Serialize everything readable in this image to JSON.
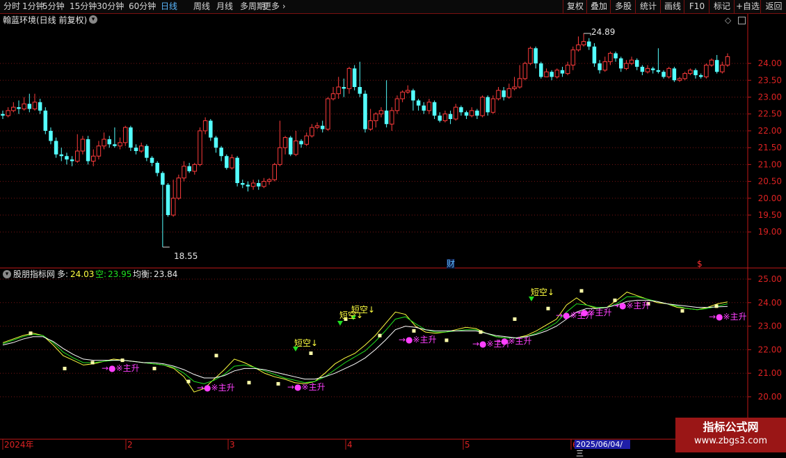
{
  "toolbar": {
    "periods": [
      "分时",
      "1分钟",
      "5分钟",
      "15分钟",
      "30分钟",
      "60分钟",
      "日线",
      "周线",
      "月线",
      "多周期",
      "更多"
    ],
    "active_period": "日线",
    "right_buttons": [
      "复权",
      "叠加",
      "多股",
      "统计",
      "画线",
      "F10",
      "标记",
      "+自选",
      "返回"
    ]
  },
  "main": {
    "title": "翰蓝环境(日线 前复权)",
    "high_label": "24.89",
    "low_label": "18.55",
    "fin_marker": "财",
    "dollar_marker": "$",
    "price_ticks": [
      "24.00",
      "23.50",
      "23.00",
      "22.50",
      "22.00",
      "21.50",
      "21.00",
      "20.50",
      "20.00",
      "19.50",
      "19.00"
    ]
  },
  "indicator": {
    "name": "股朋指标网",
    "duo_label": "多:",
    "duo_value": "24.03",
    "kong_label": "空:",
    "kong_value": "23.95",
    "jun_label": "均衡:",
    "jun_value": "23.84",
    "ticks": [
      "25.00",
      "24.00",
      "23.00",
      "22.00",
      "21.00",
      "20.00"
    ],
    "short_label": "短空↓",
    "main_up_label": "→●※主升"
  },
  "xaxis": {
    "labels": [
      "2024年",
      "2",
      "3",
      "4",
      "5",
      "6"
    ],
    "cursor_date": "2025/06/04/三"
  },
  "watermark": {
    "line1": "指标公式网",
    "line2": "www.zbgs3.com"
  },
  "colors": {
    "up": "#ff3c3c",
    "down": "#54ffff",
    "grid": "#7a1414",
    "axis": "#c01818",
    "yellow": "#ffff40",
    "magenta": "#ff40ff",
    "green": "#20e020"
  },
  "chart_data": [
    {
      "type": "candlestick",
      "title": "翰蓝环境(日线 前复权)",
      "ylim": [
        18.55,
        24.89
      ],
      "note_high": 24.89,
      "note_low": 18.55,
      "candles": [
        [
          22.5,
          22.45,
          22.6,
          22.35
        ],
        [
          22.45,
          22.6,
          22.7,
          22.4
        ],
        [
          22.6,
          22.7,
          22.85,
          22.55
        ],
        [
          22.7,
          22.65,
          22.9,
          22.5
        ],
        [
          22.65,
          22.8,
          23.0,
          22.6
        ],
        [
          22.8,
          22.65,
          23.1,
          22.55
        ],
        [
          22.65,
          22.85,
          23.1,
          22.6
        ],
        [
          22.85,
          22.6,
          22.95,
          22.5
        ],
        [
          22.6,
          22.0,
          22.7,
          21.9
        ],
        [
          22.0,
          21.7,
          22.1,
          21.6
        ],
        [
          21.7,
          21.3,
          21.8,
          21.2
        ],
        [
          21.3,
          21.25,
          21.5,
          21.1
        ],
        [
          21.25,
          21.15,
          21.35,
          21.0
        ],
        [
          21.15,
          21.1,
          21.25,
          20.95
        ],
        [
          21.1,
          21.4,
          21.9,
          21.05
        ],
        [
          21.4,
          21.75,
          21.85,
          21.3
        ],
        [
          21.75,
          21.1,
          21.85,
          21.0
        ],
        [
          21.1,
          21.25,
          21.45,
          20.95
        ],
        [
          21.25,
          21.55,
          21.7,
          21.15
        ],
        [
          21.55,
          21.75,
          21.95,
          21.45
        ],
        [
          21.75,
          21.6,
          21.85,
          21.5
        ],
        [
          21.6,
          21.55,
          22.1,
          21.5
        ],
        [
          21.55,
          21.65,
          21.8,
          21.45
        ],
        [
          21.65,
          22.1,
          22.15,
          21.55
        ],
        [
          22.1,
          21.5,
          22.15,
          21.4
        ],
        [
          21.5,
          21.4,
          21.6,
          21.3
        ],
        [
          21.4,
          21.55,
          21.65,
          21.35
        ],
        [
          21.55,
          21.2,
          21.6,
          21.1
        ],
        [
          21.2,
          21.05,
          21.25,
          20.95
        ],
        [
          21.05,
          20.75,
          21.1,
          20.65
        ],
        [
          20.75,
          20.4,
          20.8,
          18.55
        ],
        [
          20.4,
          19.5,
          20.45,
          19.45
        ],
        [
          19.5,
          20.0,
          20.55,
          19.45
        ],
        [
          20.0,
          20.6,
          20.7,
          19.95
        ],
        [
          20.6,
          20.95,
          21.1,
          20.5
        ],
        [
          20.95,
          20.8,
          21.05,
          20.75
        ],
        [
          20.8,
          21.0,
          21.05,
          20.7
        ],
        [
          21.0,
          22.0,
          22.1,
          20.95
        ],
        [
          22.0,
          22.3,
          22.4,
          21.9
        ],
        [
          22.3,
          21.8,
          22.35,
          21.7
        ],
        [
          21.8,
          21.5,
          21.85,
          21.35
        ],
        [
          21.5,
          21.25,
          21.55,
          21.1
        ],
        [
          21.25,
          20.9,
          21.3,
          20.85
        ],
        [
          20.9,
          21.2,
          21.3,
          20.85
        ],
        [
          21.2,
          20.45,
          21.25,
          20.35
        ],
        [
          20.45,
          20.4,
          20.55,
          20.3
        ],
        [
          20.4,
          20.35,
          20.5,
          20.2
        ],
        [
          20.35,
          20.45,
          20.55,
          20.25
        ],
        [
          20.45,
          20.35,
          20.55,
          20.25
        ],
        [
          20.35,
          20.5,
          20.6,
          20.3
        ],
        [
          20.5,
          20.55,
          20.6,
          20.4
        ],
        [
          20.55,
          21.0,
          21.05,
          20.5
        ],
        [
          21.0,
          21.5,
          22.3,
          20.95
        ],
        [
          21.5,
          21.8,
          21.85,
          21.3
        ],
        [
          21.8,
          21.3,
          21.85,
          21.25
        ],
        [
          21.3,
          21.7,
          22.0,
          21.25
        ],
        [
          21.7,
          21.6,
          21.75,
          21.5
        ],
        [
          21.6,
          21.85,
          21.95,
          21.55
        ],
        [
          21.85,
          22.1,
          22.2,
          21.8
        ],
        [
          22.1,
          22.15,
          22.25,
          22.05
        ],
        [
          22.15,
          22.05,
          22.3,
          21.95
        ],
        [
          22.05,
          22.95,
          23.0,
          22.0
        ],
        [
          22.95,
          23.1,
          23.3,
          22.9
        ],
        [
          23.1,
          23.3,
          23.6,
          22.95
        ],
        [
          23.3,
          23.25,
          23.55,
          23.0
        ],
        [
          23.25,
          23.85,
          23.9,
          23.1
        ],
        [
          23.85,
          23.3,
          23.95,
          23.2
        ],
        [
          23.3,
          23.1,
          24.05,
          23.0
        ],
        [
          23.1,
          22.05,
          23.2,
          21.95
        ],
        [
          22.05,
          22.3,
          22.65,
          22.0
        ],
        [
          22.3,
          22.5,
          22.55,
          22.1
        ],
        [
          22.5,
          22.6,
          22.7,
          22.4
        ],
        [
          22.6,
          22.2,
          23.5,
          22.1
        ],
        [
          22.2,
          22.6,
          22.7,
          22.0
        ],
        [
          22.6,
          22.95,
          23.05,
          22.5
        ],
        [
          22.95,
          23.15,
          23.2,
          22.85
        ],
        [
          23.15,
          23.2,
          23.35,
          23.1
        ],
        [
          23.2,
          22.9,
          23.25,
          22.6
        ],
        [
          22.9,
          22.75,
          22.95,
          22.6
        ],
        [
          22.75,
          22.6,
          22.85,
          22.5
        ],
        [
          22.6,
          22.85,
          22.95,
          22.5
        ],
        [
          22.85,
          22.45,
          22.9,
          22.35
        ],
        [
          22.45,
          22.3,
          22.55,
          22.25
        ],
        [
          22.3,
          22.5,
          22.6,
          22.25
        ],
        [
          22.5,
          22.35,
          22.6,
          22.2
        ],
        [
          22.35,
          22.7,
          22.8,
          22.3
        ],
        [
          22.7,
          22.55,
          22.75,
          22.45
        ],
        [
          22.55,
          22.45,
          22.6,
          22.35
        ],
        [
          22.45,
          22.6,
          22.7,
          22.4
        ],
        [
          22.6,
          22.45,
          22.65,
          22.35
        ],
        [
          22.45,
          23.0,
          23.05,
          22.4
        ],
        [
          23.0,
          22.55,
          23.05,
          22.45
        ],
        [
          22.55,
          22.95,
          23.05,
          22.5
        ],
        [
          22.95,
          23.2,
          23.3,
          22.9
        ],
        [
          23.2,
          23.0,
          23.3,
          22.9
        ],
        [
          23.0,
          23.25,
          23.4,
          22.95
        ],
        [
          23.25,
          23.3,
          23.6,
          23.2
        ],
        [
          23.3,
          23.55,
          23.95,
          23.25
        ],
        [
          23.55,
          24.0,
          24.05,
          23.5
        ],
        [
          24.0,
          24.45,
          24.5,
          23.95
        ],
        [
          24.45,
          24.0,
          24.5,
          23.85
        ],
        [
          24.0,
          23.6,
          24.05,
          23.55
        ],
        [
          23.6,
          23.75,
          23.85,
          23.6
        ],
        [
          23.75,
          23.6,
          23.8,
          23.5
        ],
        [
          23.6,
          23.8,
          23.85,
          23.55
        ],
        [
          23.8,
          23.7,
          23.9,
          23.6
        ],
        [
          23.7,
          23.95,
          24.05,
          23.65
        ],
        [
          23.95,
          24.4,
          24.5,
          23.8
        ],
        [
          24.4,
          24.55,
          24.8,
          24.35
        ],
        [
          24.55,
          24.65,
          24.89,
          24.5
        ],
        [
          24.65,
          24.5,
          24.75,
          24.4
        ],
        [
          24.5,
          24.0,
          24.6,
          23.9
        ],
        [
          24.0,
          23.8,
          24.1,
          23.7
        ],
        [
          23.8,
          24.05,
          24.2,
          23.75
        ],
        [
          24.05,
          24.3,
          24.35,
          23.95
        ],
        [
          24.3,
          24.15,
          24.35,
          24.05
        ],
        [
          24.15,
          23.85,
          24.2,
          23.75
        ],
        [
          23.85,
          24.0,
          24.1,
          23.8
        ],
        [
          24.0,
          24.1,
          24.2,
          23.95
        ],
        [
          24.1,
          23.9,
          24.15,
          23.8
        ],
        [
          23.9,
          23.75,
          23.95,
          23.65
        ],
        [
          23.75,
          23.85,
          23.95,
          23.7
        ],
        [
          23.85,
          23.8,
          23.9,
          23.7
        ],
        [
          23.8,
          23.75,
          24.45,
          23.7
        ],
        [
          23.75,
          23.6,
          23.8,
          23.55
        ],
        [
          23.6,
          23.85,
          23.9,
          23.55
        ],
        [
          23.85,
          23.5,
          23.9,
          23.45
        ],
        [
          23.5,
          23.55,
          23.6,
          23.45
        ],
        [
          23.55,
          23.7,
          23.75,
          23.5
        ],
        [
          23.7,
          23.8,
          23.85,
          23.65
        ],
        [
          23.8,
          23.65,
          23.85,
          23.55
        ],
        [
          23.65,
          23.6,
          23.7,
          23.55
        ],
        [
          23.6,
          23.95,
          24.0,
          23.55
        ],
        [
          23.95,
          24.1,
          24.15,
          23.9
        ],
        [
          24.1,
          23.75,
          24.25,
          23.7
        ],
        [
          23.75,
          23.95,
          24.05,
          23.7
        ],
        [
          23.95,
          24.2,
          24.3,
          23.9
        ]
      ]
    },
    {
      "type": "line",
      "title": "股朋指标网",
      "ylim": [
        19.5,
        25.3
      ],
      "series": [
        {
          "name": "多",
          "values": [
            22.3,
            22.45,
            22.6,
            22.7,
            22.6,
            22.2,
            21.75,
            21.55,
            21.35,
            21.4,
            21.5,
            21.6,
            21.55,
            21.5,
            21.45,
            21.4,
            21.35,
            21.2,
            20.85,
            20.2,
            20.35,
            20.75,
            21.15,
            21.6,
            21.45,
            21.25,
            21.0,
            20.85,
            20.75,
            20.6,
            20.55,
            20.65,
            21.0,
            21.4,
            21.65,
            21.85,
            22.2,
            22.6,
            23.1,
            23.6,
            23.5,
            23.0,
            22.75,
            22.7,
            22.75,
            22.85,
            22.95,
            22.9,
            22.7,
            22.55,
            22.5,
            22.5,
            22.6,
            22.8,
            23.05,
            23.3,
            23.9,
            24.2,
            23.9,
            23.75,
            23.8,
            24.1,
            24.45,
            24.3,
            24.15,
            24.0,
            23.95,
            23.8,
            23.75,
            23.7,
            23.8,
            23.95,
            24.03
          ]
        },
        {
          "name": "空",
          "values": [
            22.25,
            22.4,
            22.55,
            22.65,
            22.6,
            22.3,
            21.9,
            21.65,
            21.45,
            21.45,
            21.5,
            21.55,
            21.55,
            21.5,
            21.45,
            21.4,
            21.35,
            21.25,
            21.0,
            20.65,
            20.55,
            20.7,
            20.95,
            21.3,
            21.35,
            21.25,
            21.1,
            20.95,
            20.8,
            20.7,
            20.6,
            20.65,
            20.85,
            21.15,
            21.45,
            21.7,
            21.95,
            22.35,
            22.8,
            23.3,
            23.4,
            23.1,
            22.85,
            22.75,
            22.75,
            22.8,
            22.85,
            22.85,
            22.7,
            22.55,
            22.5,
            22.5,
            22.55,
            22.7,
            22.9,
            23.15,
            23.6,
            23.95,
            23.9,
            23.8,
            23.8,
            23.95,
            24.25,
            24.25,
            24.15,
            24.05,
            23.95,
            23.85,
            23.75,
            23.7,
            23.75,
            23.85,
            23.95
          ]
        },
        {
          "name": "均衡",
          "values": [
            22.2,
            22.3,
            22.45,
            22.55,
            22.55,
            22.35,
            22.05,
            21.8,
            21.6,
            21.55,
            21.55,
            21.55,
            21.55,
            21.5,
            21.45,
            21.45,
            21.4,
            21.3,
            21.15,
            20.95,
            20.8,
            20.8,
            20.9,
            21.1,
            21.2,
            21.2,
            21.15,
            21.05,
            20.95,
            20.85,
            20.75,
            20.75,
            20.85,
            21.0,
            21.2,
            21.4,
            21.65,
            22.0,
            22.4,
            22.85,
            23.0,
            22.95,
            22.85,
            22.8,
            22.8,
            22.8,
            22.8,
            22.8,
            22.7,
            22.6,
            22.55,
            22.5,
            22.55,
            22.65,
            22.8,
            23.0,
            23.3,
            23.6,
            23.75,
            23.75,
            23.8,
            23.9,
            24.05,
            24.1,
            24.1,
            24.05,
            23.95,
            23.9,
            23.85,
            23.8,
            23.8,
            23.82,
            23.84
          ]
        }
      ]
    }
  ]
}
